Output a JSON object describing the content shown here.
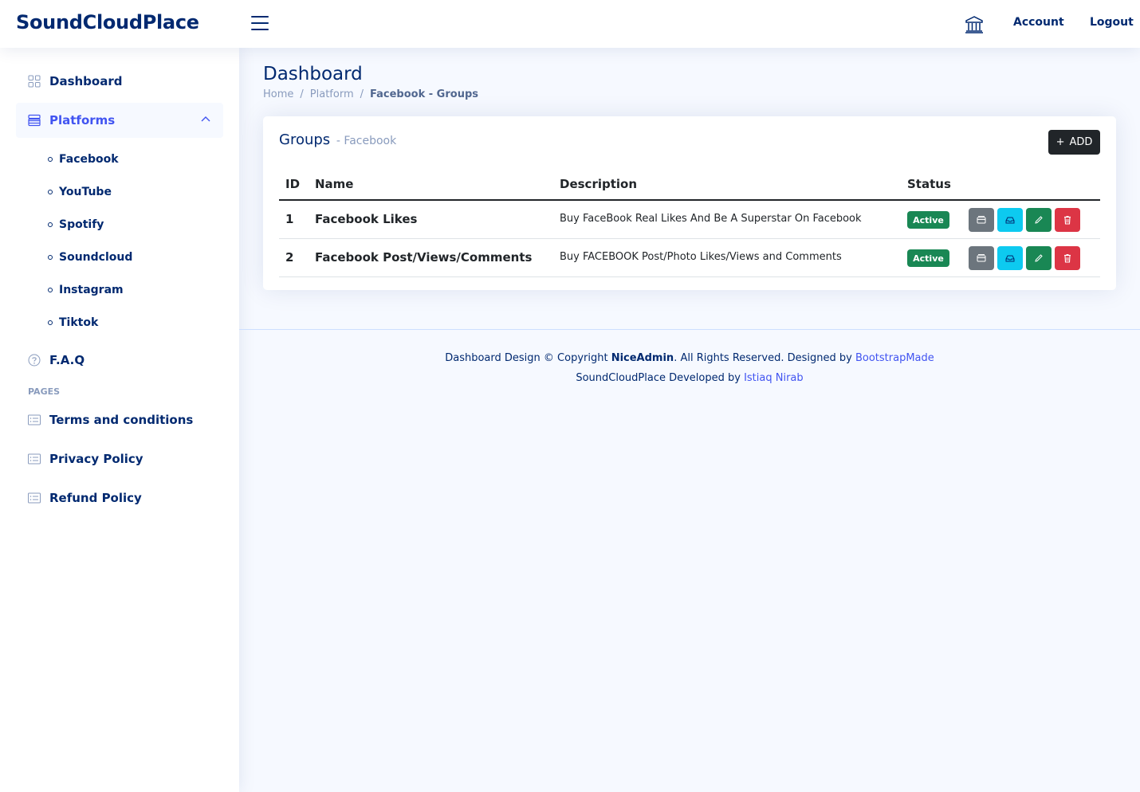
{
  "header": {
    "logo": "SoundCloudPlace",
    "account": "Account",
    "logout": "Logout"
  },
  "sidebar": {
    "dashboard": "Dashboard",
    "platforms": "Platforms",
    "platform_items": [
      "Facebook",
      "YouTube",
      "Spotify",
      "Soundcloud",
      "Instagram",
      "Tiktok"
    ],
    "faq": "F.A.Q",
    "pages_heading": "PAGES",
    "pages": [
      "Terms and conditions",
      "Privacy Policy",
      "Refund Policy"
    ]
  },
  "main": {
    "title": "Dashboard",
    "breadcrumb": [
      "Home",
      "Platform",
      "Facebook - Groups"
    ],
    "card": {
      "title": "Groups",
      "subtitle": "- Facebook",
      "add_label": "ADD",
      "columns": [
        "ID",
        "Name",
        "Description",
        "Status"
      ],
      "rows": [
        {
          "id": "1",
          "name": "Facebook Likes",
          "description": "Buy FaceBook Real Likes And Be A Superstar On Facebook",
          "status": "Active"
        },
        {
          "id": "2",
          "name": "Facebook Post/Views/Comments",
          "description": "Buy FACEBOOK Post/Photo Likes/Views and Comments",
          "status": "Active"
        }
      ]
    }
  },
  "footer": {
    "line1_prefix": "Dashboard Design © Copyright ",
    "line1_brand": "NiceAdmin",
    "line1_middle": ". All Rights Reserved. Designed by ",
    "line1_link": "BootstrapMade",
    "line2_prefix": "SoundCloudPlace Developed by ",
    "line2_link": "Istiaq Nirab"
  },
  "colors": {
    "navy": "#012970",
    "accent": "#4154f1",
    "active_badge": "#198754",
    "danger": "#dc3545",
    "info": "#0dcaf0",
    "secondary": "#6c757d"
  },
  "icons": {
    "toggle": "list-icon",
    "bank": "bank-icon",
    "dashboard": "grid-icon",
    "platforms": "menu-button-icon",
    "faq": "question-circle-icon",
    "page": "card-list-icon",
    "row_actions": [
      "archive-icon",
      "inbox-icon",
      "pencil-icon",
      "trash-icon"
    ]
  }
}
